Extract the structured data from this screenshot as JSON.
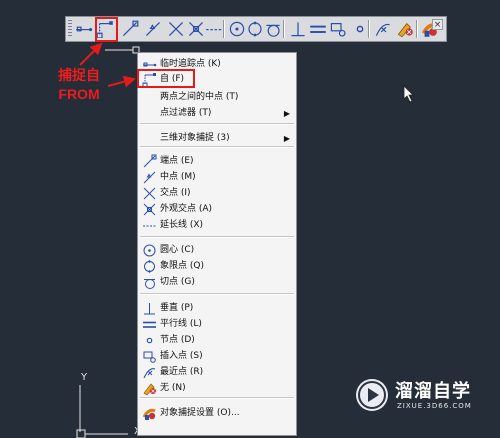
{
  "annotation": {
    "line1": "捕捉自",
    "line2": "FROM"
  },
  "toolbar": {
    "close_label": "×",
    "buttons": [
      {
        "name": "temporary-track-point-icon"
      },
      {
        "name": "snap-from-icon"
      },
      {
        "name": "endpoint-icon"
      },
      {
        "name": "midpoint-icon"
      },
      {
        "name": "intersection-icon"
      },
      {
        "name": "apparent-intersection-icon"
      },
      {
        "name": "extension-icon"
      },
      {
        "name": "center-icon"
      },
      {
        "name": "quadrant-icon"
      },
      {
        "name": "tangent-icon"
      },
      {
        "name": "perpendicular-icon"
      },
      {
        "name": "parallel-icon"
      },
      {
        "name": "insert-icon"
      },
      {
        "name": "node-icon"
      },
      {
        "name": "nearest-icon"
      },
      {
        "name": "none-icon"
      },
      {
        "name": "osnap-settings-icon"
      }
    ]
  },
  "menu": {
    "items": [
      {
        "label": "临时追踪点 (K)",
        "icon": "temporary-track-point-icon"
      },
      {
        "label": "自 (F)",
        "icon": "snap-from-icon"
      },
      {
        "label": "两点之间的中点 (T)",
        "icon": ""
      },
      {
        "label": "点过滤器 (T)",
        "icon": "",
        "submenu": "▶"
      },
      {
        "label": "三维对象捕捉 (3)",
        "icon": "",
        "submenu": "▶"
      },
      {
        "label": "端点 (E)",
        "icon": "endpoint-icon"
      },
      {
        "label": "中点 (M)",
        "icon": "midpoint-icon"
      },
      {
        "label": "交点 (I)",
        "icon": "intersection-icon"
      },
      {
        "label": "外观交点 (A)",
        "icon": "apparent-intersection-icon"
      },
      {
        "label": "延长线 (X)",
        "icon": "extension-icon"
      },
      {
        "label": "圆心 (C)",
        "icon": "center-icon"
      },
      {
        "label": "象限点 (Q)",
        "icon": "quadrant-icon"
      },
      {
        "label": "切点 (G)",
        "icon": "tangent-icon"
      },
      {
        "label": "垂直 (P)",
        "icon": "perpendicular-icon"
      },
      {
        "label": "平行线 (L)",
        "icon": "parallel-icon"
      },
      {
        "label": "节点 (D)",
        "icon": "node-icon"
      },
      {
        "label": "插入点 (S)",
        "icon": "insert-icon"
      },
      {
        "label": "最近点 (R)",
        "icon": "nearest-icon"
      },
      {
        "label": "无 (N)",
        "icon": "none-icon"
      },
      {
        "label": "对象捕捉设置 (O)...",
        "icon": "osnap-settings-icon"
      }
    ]
  },
  "ucs": {
    "y_label": "Y",
    "x_label": "X"
  },
  "watermark": {
    "title": "溜溜自学",
    "url": "ZIXUE.3D66.COM"
  },
  "colors": {
    "accent_red": "#e21b1b",
    "icon_blue": "#2a4fa8",
    "background": "#252d38"
  }
}
